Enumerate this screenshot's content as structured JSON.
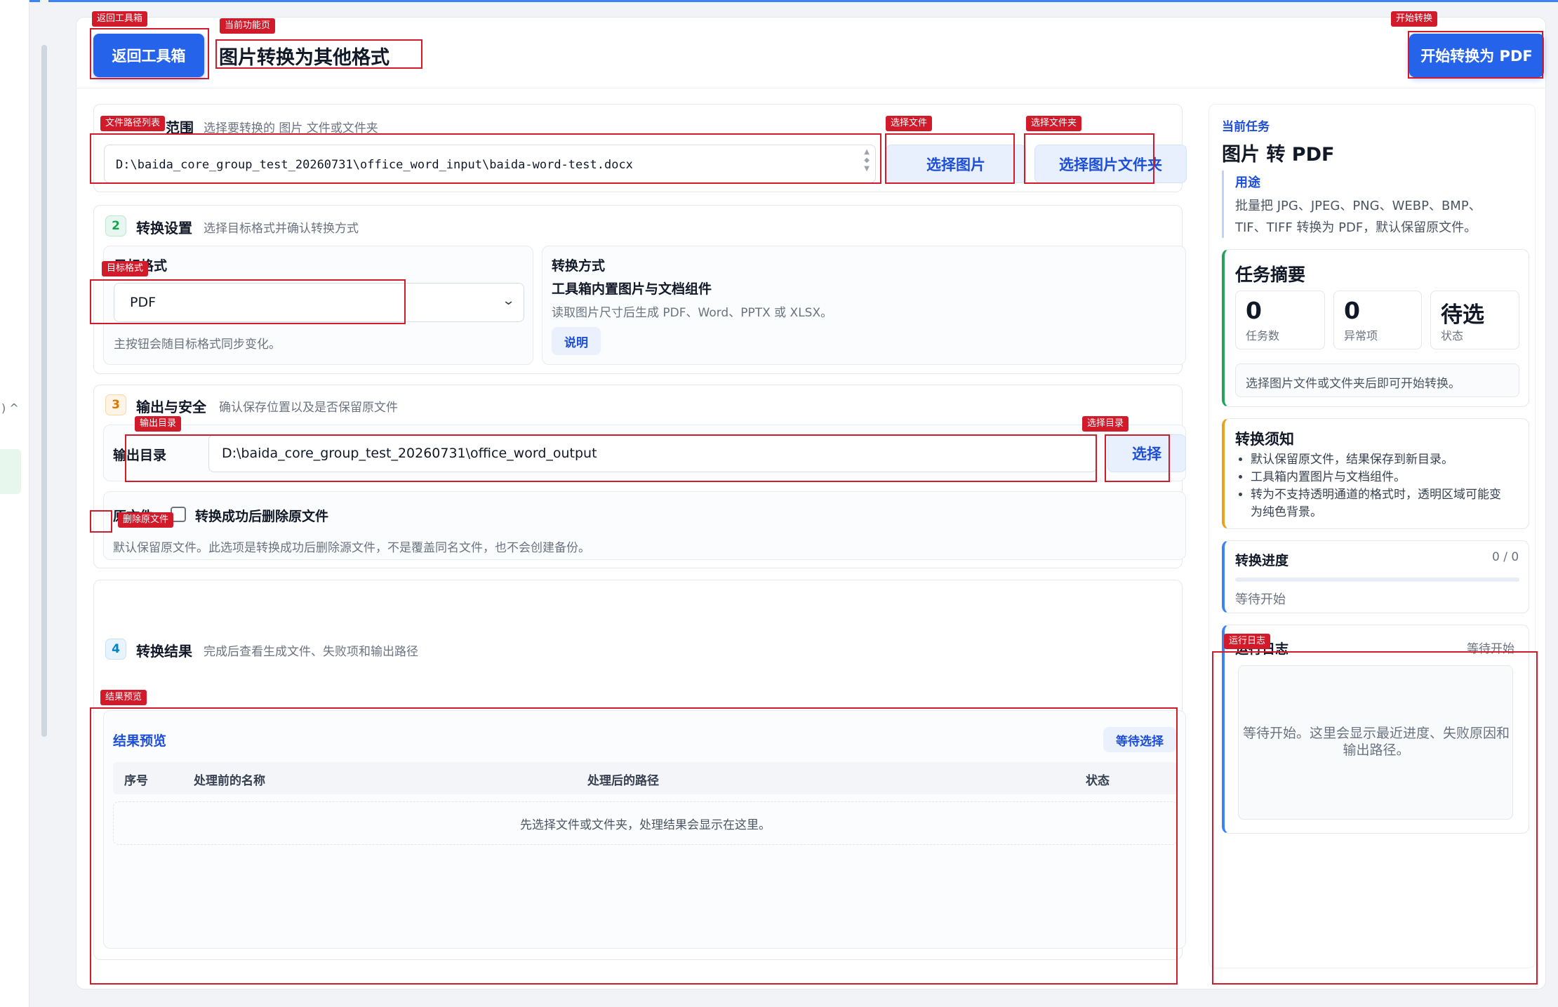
{
  "header": {
    "back_button": "返回工具箱",
    "page_title": "图片转换为其他格式",
    "start_button": "开始转换为 PDF"
  },
  "left_stub": {
    "text": ") ^"
  },
  "section1": {
    "title_visible": "范围",
    "subtitle": "选择要转换的 图片 文件或文件夹",
    "path_value": "D:\\baida_core_group_test_20260731\\office_word_input\\baida-word-test.docx",
    "select_files_button": "选择图片",
    "select_folder_button": "选择图片文件夹"
  },
  "section2": {
    "number": "2",
    "title": "转换设置",
    "subtitle": "选择目标格式并确认转换方式",
    "target_label": "目标格式",
    "target_value": "PDF",
    "target_hint": "主按钮会随目标格式同步变化。",
    "method_label": "转换方式",
    "method_name": "工具箱内置图片与文档组件",
    "method_desc": "读取图片尺寸后生成 PDF、Word、PPTX 或 XLSX。",
    "explain_button": "说明"
  },
  "section3": {
    "number": "3",
    "title": "输出与安全",
    "subtitle": "确认保存位置以及是否保留原文件",
    "output_label": "输出目录",
    "output_value": "D:\\baida_core_group_test_20260731\\office_word_output",
    "choose_button": "选择",
    "source_label": "原文件",
    "delete_checkbox_label": "转换成功后删除原文件",
    "delete_hint": "默认保留原文件。此选项是转换成功后删除源文件，不是覆盖同名文件，也不会创建备份。"
  },
  "section4": {
    "number": "4",
    "title": "转换结果",
    "subtitle": "完成后查看生成文件、失败项和输出路径",
    "preview_title": "结果预览",
    "status_pill": "等待选择",
    "columns": [
      "序号",
      "处理前的名称",
      "处理后的路径",
      "状态"
    ],
    "empty_text": "先选择文件或文件夹，处理结果会显示在这里。"
  },
  "right": {
    "kicker": "当前任务",
    "task_title": "图片 转 PDF",
    "usage_label": "用途",
    "usage_text_1": "批量把 JPG、JPEG、PNG、WEBP、BMP、",
    "usage_text_2": "TIF、TIFF 转换为 PDF，默认保留原文件。",
    "summary_title": "任务摘要",
    "stats": [
      {
        "value": "0",
        "label": "任务数"
      },
      {
        "value": "0",
        "label": "异常项"
      },
      {
        "value": "待选",
        "label": "状态"
      }
    ],
    "summary_hint": "选择图片文件或文件夹后即可开始转换。",
    "notice_title": "转换须知",
    "notices": [
      "默认保留原文件，结果保存到新目录。",
      "工具箱内置图片与文档组件。",
      "转为不支持透明通道的格式时，透明区域可能变",
      "为纯色背景。"
    ],
    "progress_title": "转换进度",
    "progress_count": "0 / 0",
    "progress_fraction": 0,
    "progress_status": "等待开始",
    "log_title": "运行日志",
    "log_status": "等待开始",
    "log_text_1": "等待开始。这里会显示最近进度、失败原因和",
    "log_text_2": "输出路径。"
  },
  "annotations": {
    "back": "返回工具箱",
    "current_page": "当前功能页",
    "start": "开始转换",
    "path_list": "文件路径列表",
    "select_file": "选择文件",
    "select_folder": "选择文件夹",
    "target_format": "目标格式",
    "output_dir": "输出目录",
    "select_dir": "选择目录",
    "delete_source": "删除原文件",
    "result_preview": "结果预览",
    "run_log": "运行日志"
  }
}
